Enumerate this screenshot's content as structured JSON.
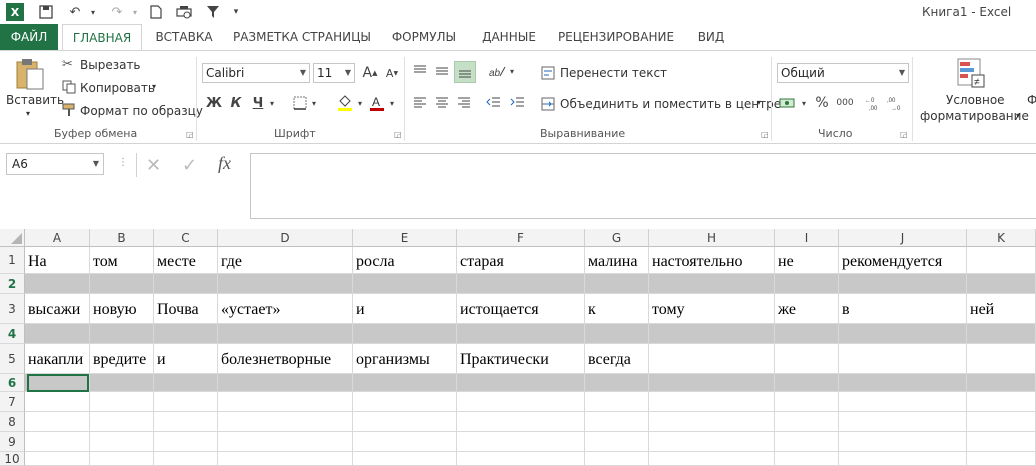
{
  "titlebar": {
    "title": "Книга1 - Excel",
    "quick_access": [
      {
        "name": "excel-logo-icon",
        "glyph": "X"
      },
      {
        "name": "save-icon",
        "glyph": "💾"
      },
      {
        "name": "undo-icon",
        "glyph": "↶"
      },
      {
        "name": "redo-icon",
        "glyph": "↷"
      },
      {
        "name": "new-file-icon",
        "glyph": "🗋"
      },
      {
        "name": "print-preview-icon",
        "glyph": "⎙"
      },
      {
        "name": "filter-icon",
        "glyph": "▼"
      },
      {
        "name": "customize-qa-icon",
        "glyph": "▾"
      }
    ]
  },
  "tabs": [
    {
      "label": "ФАЙЛ"
    },
    {
      "label": "ГЛАВНАЯ"
    },
    {
      "label": "ВСТАВКА"
    },
    {
      "label": "РАЗМЕТКА СТРАНИЦЫ"
    },
    {
      "label": "ФОРМУЛЫ"
    },
    {
      "label": "ДАННЫЕ"
    },
    {
      "label": "РЕЦЕНЗИРОВАНИЕ"
    },
    {
      "label": "ВИД"
    }
  ],
  "ribbon": {
    "clipboard": {
      "paste": "Вставить",
      "cut": "Вырезать",
      "copy": "Копировать",
      "format_painter": "Формат по образцу",
      "group": "Буфер обмена"
    },
    "font": {
      "name": "Calibri",
      "size": "11",
      "grow": "A",
      "shrink": "A",
      "bold": "Ж",
      "italic": "К",
      "underline": "Ч",
      "group": "Шрифт"
    },
    "alignment": {
      "wrap": "Перенести текст",
      "merge": "Объединить и поместить в центре",
      "group": "Выравнивание"
    },
    "number": {
      "format": "Общий",
      "percent": "%",
      "thousands": "000",
      "group": "Число"
    },
    "styles": {
      "conditional_line1": "Условное",
      "conditional_line2": "форматирование",
      "cut_label": "Ф"
    }
  },
  "formula_bar": {
    "name_box": "A6",
    "fx": "fx",
    "cancel": "✕",
    "enter": "✓"
  },
  "grid": {
    "columns": [
      "A",
      "B",
      "C",
      "D",
      "E",
      "F",
      "G",
      "H",
      "I",
      "J",
      "K"
    ],
    "rows": [
      {
        "num": "1",
        "cells": [
          "На",
          "том",
          "месте",
          "где",
          "росла",
          "старая",
          "малина",
          "настоятельно",
          "не",
          "рекомендуется",
          ""
        ]
      },
      {
        "num": "2",
        "cells": [
          "",
          "",
          "",
          "",
          "",
          "",
          "",
          "",
          "",
          "",
          ""
        ]
      },
      {
        "num": "3",
        "cells": [
          "высажи",
          "новую",
          "Почва",
          "«устает»",
          "и",
          "истощается",
          "к",
          "тому",
          "же",
          "в",
          "ней"
        ]
      },
      {
        "num": "4",
        "cells": [
          "",
          "",
          "",
          "",
          "",
          "",
          "",
          "",
          "",
          "",
          ""
        ]
      },
      {
        "num": "5",
        "cells": [
          "накапли",
          "вредите",
          "и",
          "болезнетворные",
          "организмы",
          "Практически",
          "всегда",
          "",
          "",
          "",
          ""
        ]
      },
      {
        "num": "6",
        "cells": [
          "",
          "",
          "",
          "",
          "",
          "",
          "",
          "",
          "",
          "",
          ""
        ]
      },
      {
        "num": "7",
        "cells": [
          "",
          "",
          "",
          "",
          "",
          "",
          "",
          "",
          "",
          "",
          ""
        ]
      },
      {
        "num": "8",
        "cells": [
          "",
          "",
          "",
          "",
          "",
          "",
          "",
          "",
          "",
          "",
          ""
        ]
      },
      {
        "num": "9",
        "cells": [
          "",
          "",
          "",
          "",
          "",
          "",
          "",
          "",
          "",
          "",
          ""
        ]
      },
      {
        "num": "10",
        "cells": [
          "",
          "",
          "",
          "",
          "",
          "",
          "",
          "",
          "",
          "",
          ""
        ]
      }
    ]
  },
  "colors": {
    "excel_green": "#217346",
    "grey_row": "#c8c8c8",
    "font_color_red": "#c00000",
    "highlight_yellow": "#ffff00"
  }
}
